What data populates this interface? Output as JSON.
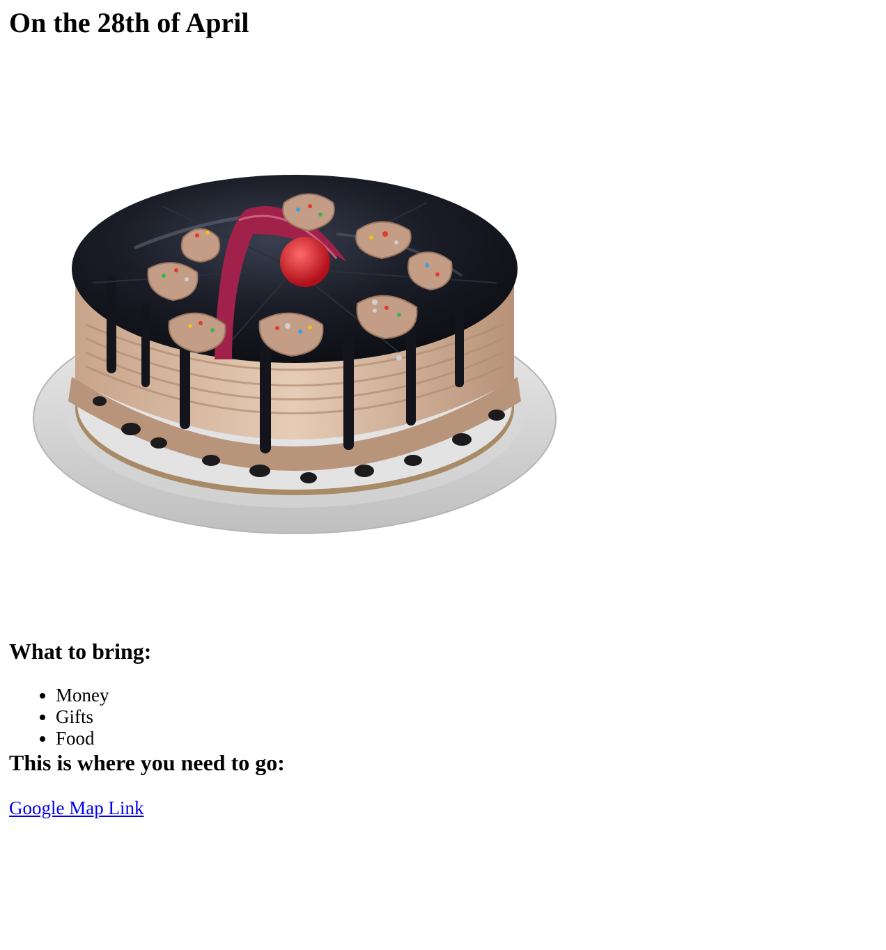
{
  "heading": "On the 28th of April",
  "image": {
    "icon": "birthday-cake-photo"
  },
  "bring": {
    "heading": "What to bring:",
    "items": [
      "Money",
      "Gifts",
      "Food"
    ]
  },
  "location": {
    "heading": "This is where you need to go:",
    "link_label": "Google Map Link"
  },
  "colors": {
    "link": "#0000ee",
    "text": "#000000",
    "background": "#ffffff"
  }
}
